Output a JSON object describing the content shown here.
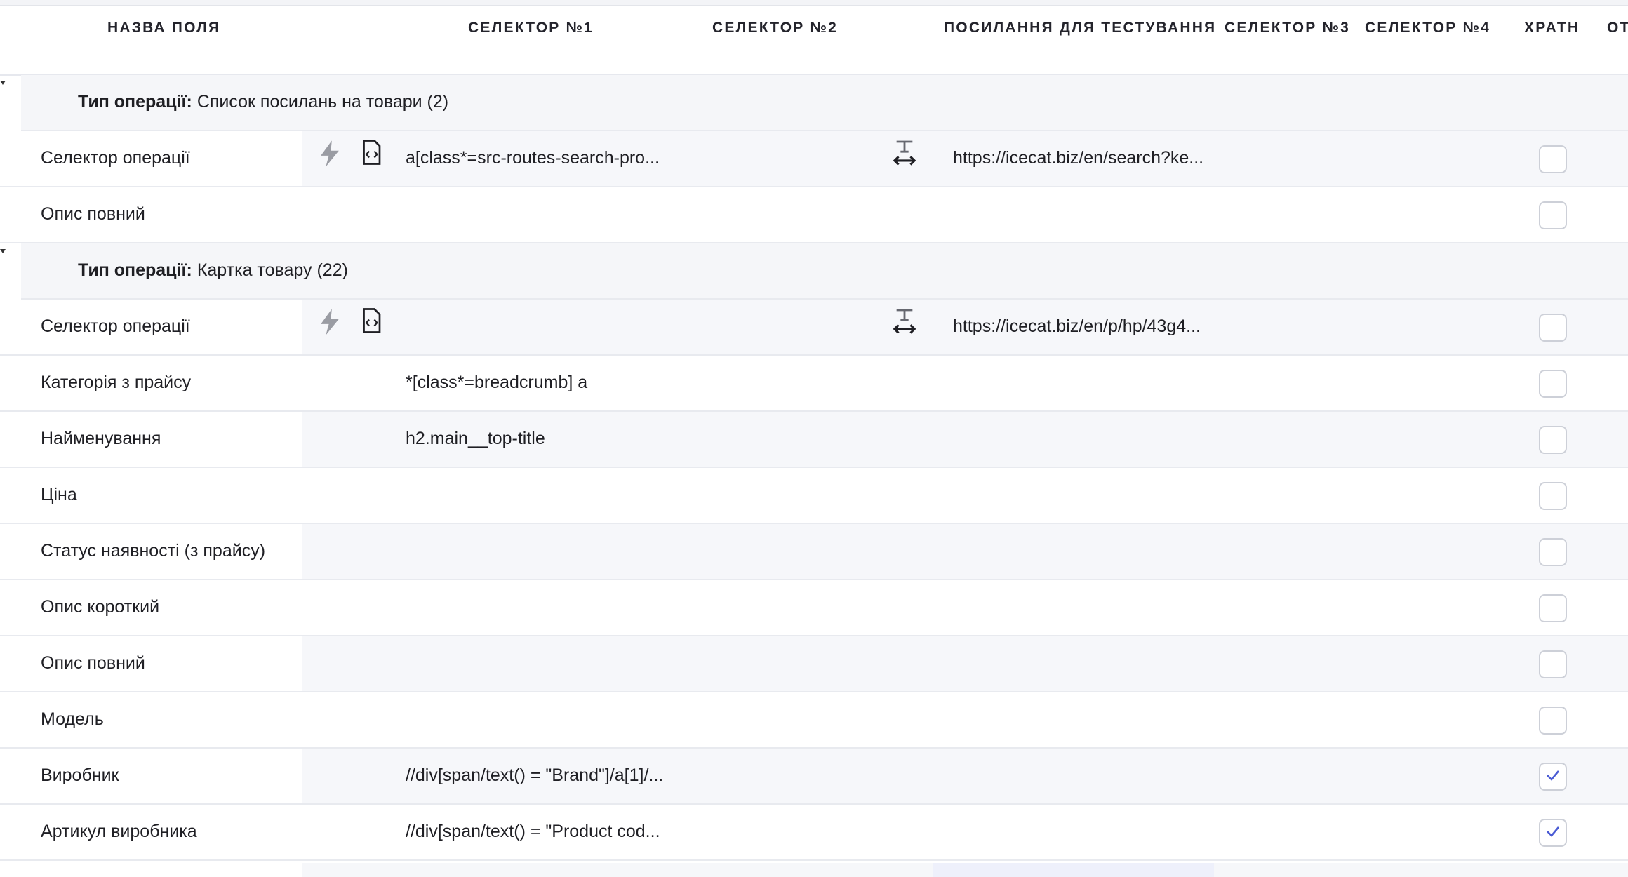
{
  "headers": {
    "field_name": "НАЗВА ПОЛЯ",
    "selector1": "СЕЛЕКТОР №1",
    "selector2": "СЕЛЕКТОР №2",
    "test_link": "ПОСИЛАННЯ ДЛЯ ТЕСТУВАННЯ",
    "selector3": "СЕЛЕКТОР №3",
    "selector4": "СЕЛЕКТОР №4",
    "store": "ХРАТН",
    "cut": "ОТ"
  },
  "groups": [
    {
      "label_bold": "Тип операції:",
      "label_text": "Список посилань на товари (2)",
      "rows": [
        {
          "name": "Селектор операції",
          "selector1": "a[class*=src-routes-search-pro...",
          "url": "https://icecat.biz/en/search?ke...",
          "icons": true,
          "checked": false
        },
        {
          "name": "Опис повний",
          "selector1": "",
          "url": "",
          "icons": false,
          "checked": false
        }
      ]
    },
    {
      "label_bold": "Тип операції:",
      "label_text": "Картка товару (22)",
      "rows": [
        {
          "name": "Селектор операції",
          "selector1": "",
          "url": "https://icecat.biz/en/p/hp/43g4...",
          "icons": true,
          "checked": false
        },
        {
          "name": "Категорія з прайсу",
          "selector1": "*[class*=breadcrumb] a",
          "url": "",
          "icons": false,
          "checked": false
        },
        {
          "name": "Найменування",
          "selector1": "h2.main__top-title",
          "url": "",
          "icons": false,
          "checked": false
        },
        {
          "name": "Ціна",
          "selector1": "",
          "url": "",
          "icons": false,
          "checked": false
        },
        {
          "name": "Статус наявності (з прайсу)",
          "selector1": "",
          "url": "",
          "icons": false,
          "checked": false
        },
        {
          "name": "Опис короткий",
          "selector1": "",
          "url": "",
          "icons": false,
          "checked": false
        },
        {
          "name": "Опис повний",
          "selector1": "",
          "url": "",
          "icons": false,
          "checked": false
        },
        {
          "name": "Модель",
          "selector1": "",
          "url": "",
          "icons": false,
          "checked": false
        },
        {
          "name": "Виробник",
          "selector1": "//div[span/text() = \"Brand\"]/a[1]/...",
          "url": "",
          "icons": false,
          "checked": true
        },
        {
          "name": "Артикул виробника",
          "selector1": "//div[span/text() = \"Product cod...",
          "url": "",
          "icons": false,
          "checked": true
        }
      ]
    }
  ],
  "colors": {
    "accent": "#4a5bd4",
    "row_alt": "#f6f7fa",
    "icon_gray": "#9a9ca3"
  }
}
